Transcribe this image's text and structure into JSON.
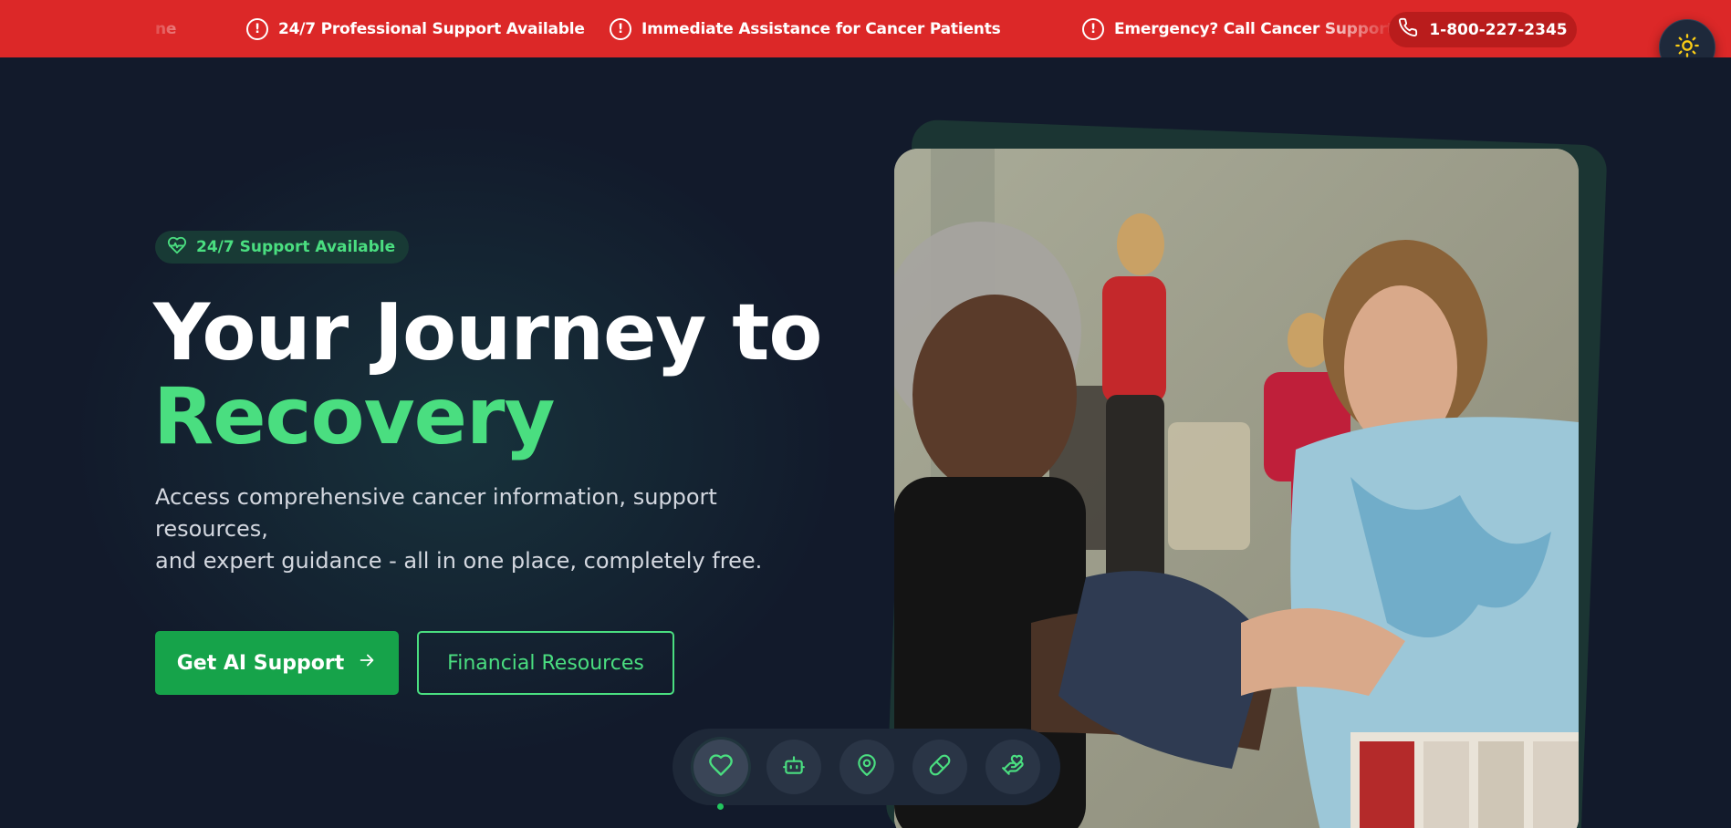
{
  "alert_bar": {
    "items": [
      {
        "text": "ne"
      },
      {
        "text": "24/7 Professional Support Available"
      },
      {
        "text": "Immediate Assistance for Cancer Patients"
      },
      {
        "text": "Emergency? Call Cancer Support Hotl"
      }
    ],
    "alert_icon_glyph": "!",
    "hotline_number": "1-800-227-2345"
  },
  "hero": {
    "badge": "24/7 Support Available",
    "headline_line1": "Your Journey to",
    "headline_line2": "Recovery",
    "lead_line1": "Access comprehensive cancer information, support resources,",
    "lead_line2": "and expert guidance - all in one place, completely free.",
    "primary_button": "Get AI Support",
    "secondary_button": "Financial Resources"
  },
  "dock": {
    "items": [
      {
        "icon": "heart-icon",
        "active": true
      },
      {
        "icon": "bot-icon",
        "active": false
      },
      {
        "icon": "map-pin-icon",
        "active": false
      },
      {
        "icon": "pill-icon",
        "active": false
      },
      {
        "icon": "hand-heart-icon",
        "active": false
      }
    ]
  },
  "colors": {
    "alert_red": "#dc2828",
    "accent_green": "#4ade80",
    "primary_green": "#16a34a",
    "background": "#121a2b"
  }
}
